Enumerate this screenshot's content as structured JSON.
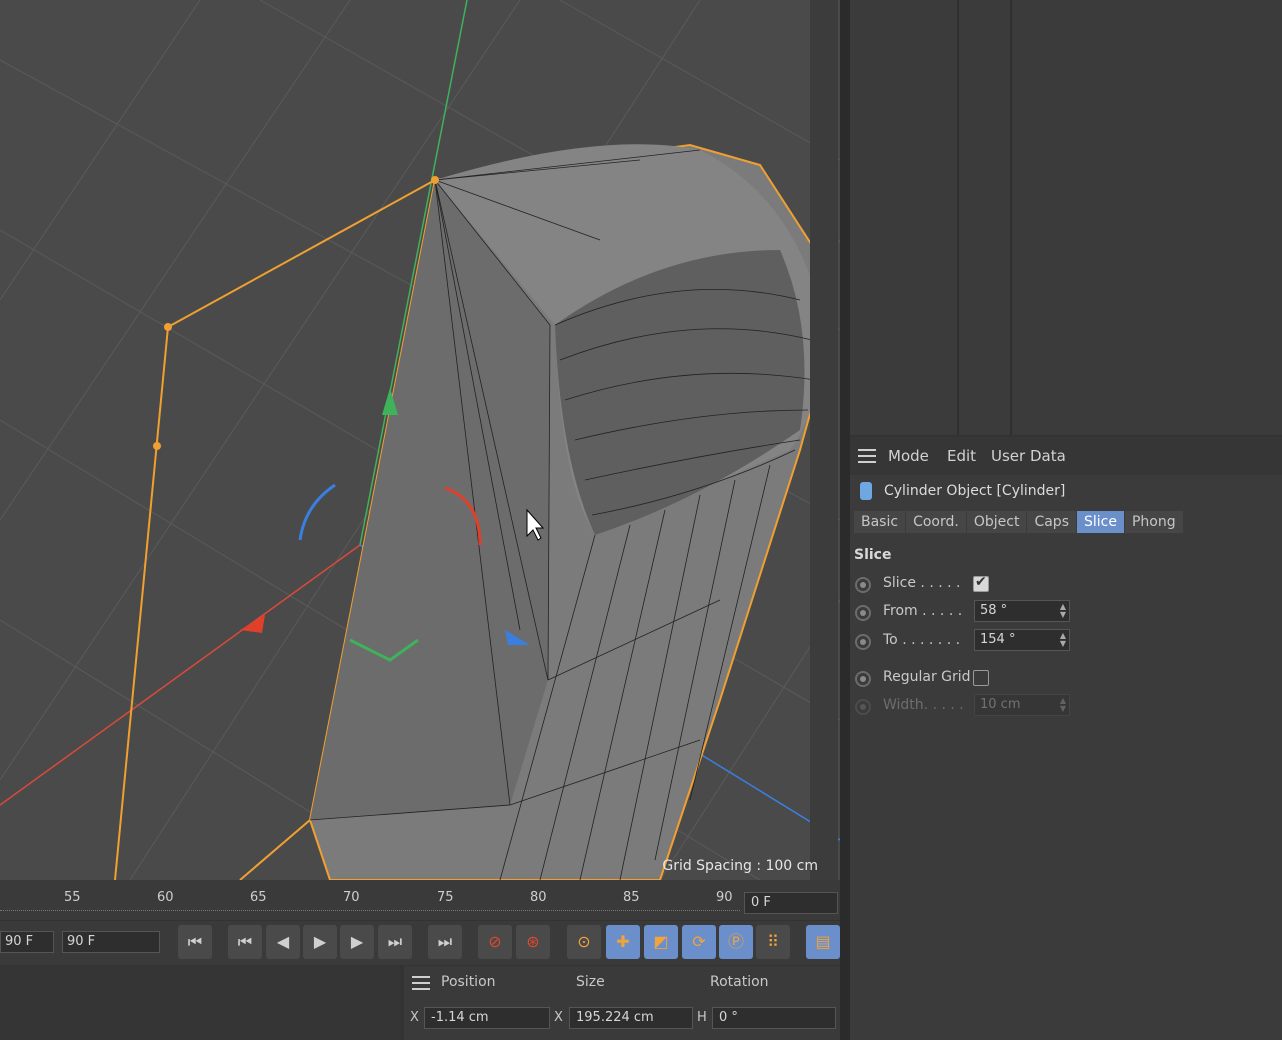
{
  "viewport": {
    "grid_spacing": "Grid Spacing : 100 cm"
  },
  "attributes": {
    "menu": {
      "mode": "Mode",
      "edit": "Edit",
      "user_data": "User Data"
    },
    "object_title": "Cylinder Object [Cylinder]",
    "tabs": [
      "Basic",
      "Coord.",
      "Object",
      "Caps",
      "Slice",
      "Phong"
    ],
    "active_tab": "Slice",
    "section": "Slice",
    "props": {
      "slice_label": "Slice . . . . .",
      "slice_checked": true,
      "from_label": "From . . . . .",
      "from_value": "58 °",
      "to_label": "To . . . . . . .",
      "to_value": "154 °",
      "regular_grid_label": "Regular Grid",
      "regular_grid_checked": false,
      "width_label": "Width. . . . .",
      "width_value": "10 cm"
    }
  },
  "timeline": {
    "ticks": [
      "55",
      "60",
      "65",
      "70",
      "75",
      "80",
      "85",
      "90"
    ],
    "current_frame": "0 F"
  },
  "transport": {
    "start_field": "90 F",
    "end_field": "90 F"
  },
  "coordinates": {
    "headers": {
      "position": "Position",
      "size": "Size",
      "rotation": "Rotation"
    },
    "x_label": "X",
    "x_position": "-1.14 cm",
    "x_size": "195.224 cm",
    "h_label": "H",
    "h_rotation": "0 °"
  },
  "colors": {
    "accent": "#6a8fcb",
    "selection_outline": "#f0a030",
    "axis_x": "#e0402a",
    "axis_y": "#3fb25a",
    "axis_z": "#3a7fe0"
  }
}
